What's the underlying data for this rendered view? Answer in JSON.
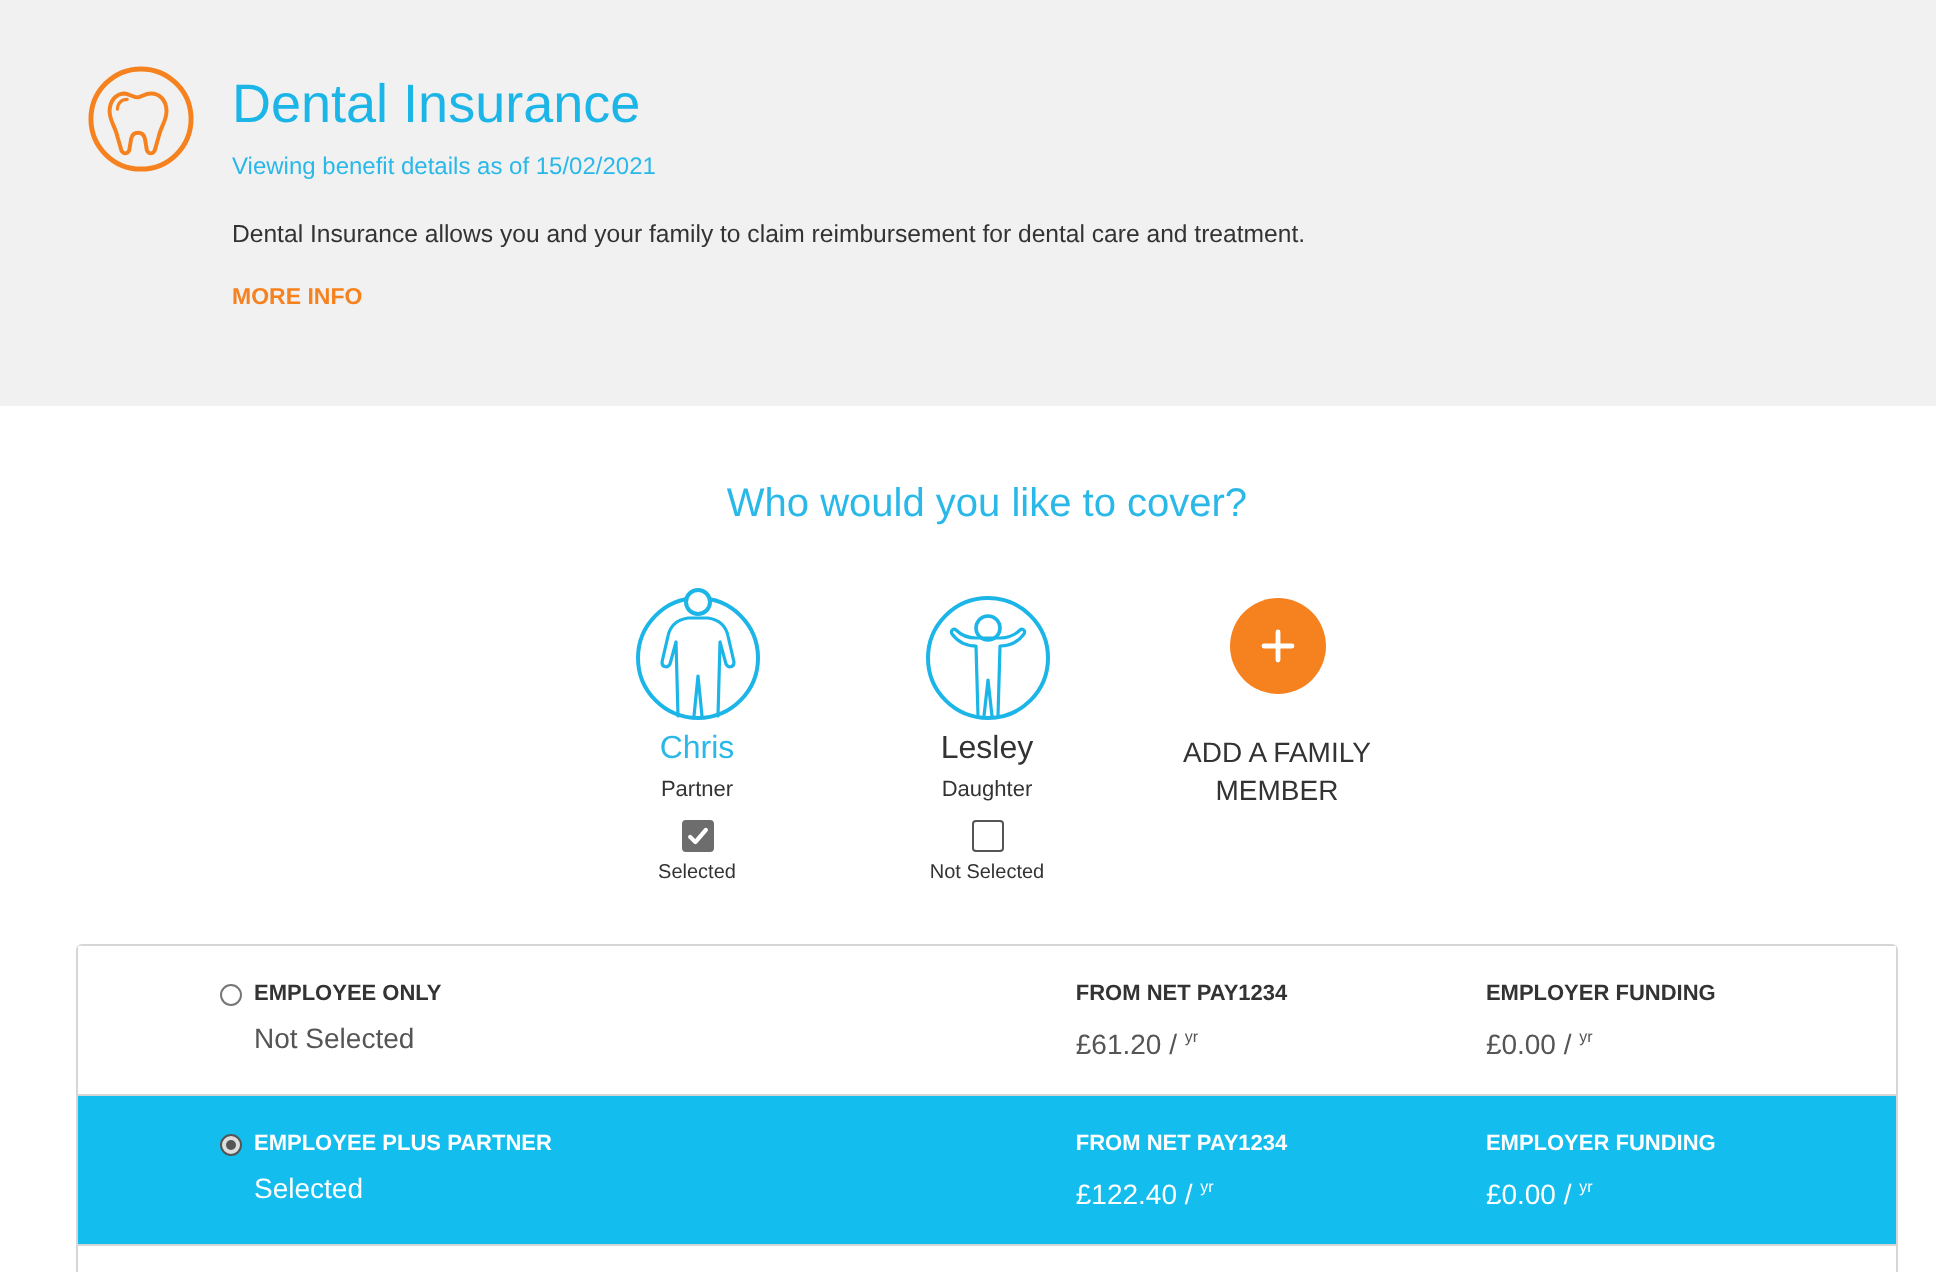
{
  "header": {
    "title": "Dental Insurance",
    "subtitle": "Viewing benefit details as of 15/02/2021",
    "description": "Dental Insurance allows you and your family to claim reimbursement for dental care and treatment.",
    "more_info": "MORE INFO"
  },
  "cover": {
    "heading": "Who would you like to cover?",
    "members": [
      {
        "kind": "adult",
        "name": "Chris",
        "relation": "Partner",
        "checked": true,
        "status": "Selected"
      },
      {
        "kind": "child",
        "name": "Lesley",
        "relation": "Daughter",
        "checked": false,
        "status": "Not Selected"
      }
    ],
    "add_member": "ADD A FAMILY MEMBER"
  },
  "options": [
    {
      "label": "EMPLOYEE ONLY",
      "status": "Not Selected",
      "selected": false,
      "columns": [
        {
          "heading": "FROM NET PAY1234",
          "amount": "£61.20 / $^{yr}$"
        },
        {
          "heading": "EMPLOYER FUNDING",
          "amount": "£0.00 / $^{yr}$"
        }
      ]
    },
    {
      "label": "EMPLOYEE PLUS PARTNER",
      "status": "Selected",
      "selected": true,
      "columns": [
        {
          "heading": "FROM NET PAY1234",
          "amount": "£122.40 / $^{yr}$"
        },
        {
          "heading": "EMPLOYER FUNDING",
          "amount": "£0.00 / $^{yr}$"
        }
      ]
    }
  ]
}
